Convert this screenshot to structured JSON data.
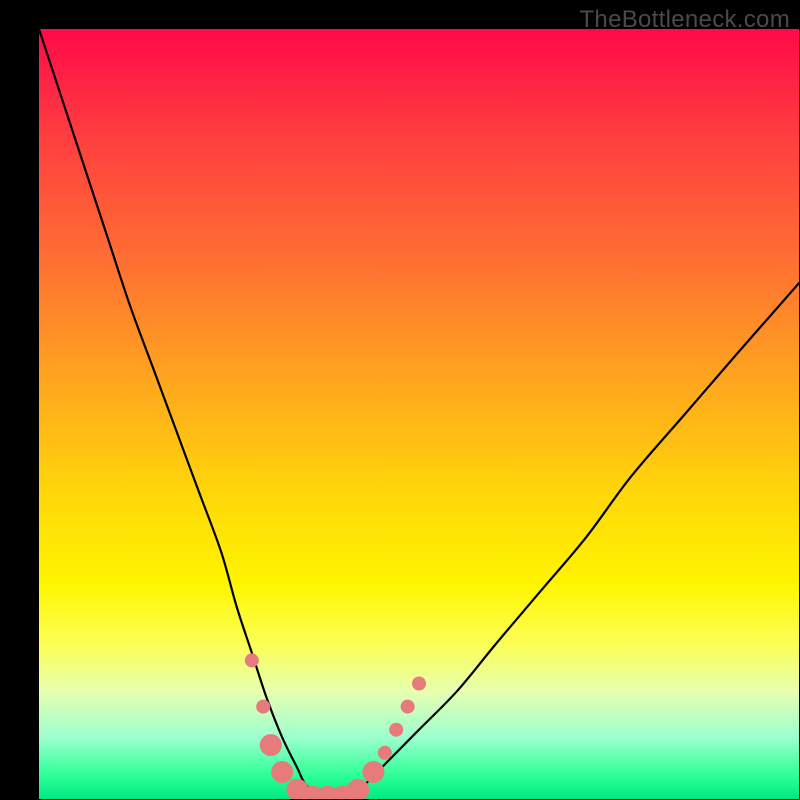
{
  "watermark": "TheBottleneck.com",
  "chart_data": {
    "type": "line",
    "title": "",
    "xlabel": "",
    "ylabel": "",
    "xlim": [
      0,
      100
    ],
    "ylim": [
      0,
      100
    ],
    "series": [
      {
        "name": "bottleneck-curve",
        "x": [
          0,
          3,
          6,
          9,
          12,
          15,
          18,
          21,
          24,
          26,
          28,
          30,
          32,
          34,
          35,
          37,
          39,
          41,
          43,
          46,
          50,
          55,
          60,
          66,
          72,
          78,
          85,
          92,
          100
        ],
        "values": [
          100,
          91,
          82,
          73,
          64,
          56,
          48,
          40,
          32,
          25,
          19,
          13,
          8,
          4,
          2,
          0,
          0,
          0,
          2,
          5,
          9,
          14,
          20,
          27,
          34,
          42,
          50,
          58,
          67
        ]
      }
    ],
    "markers": {
      "name": "highlight-points",
      "color": "#e77a7a",
      "radius_small": 7,
      "radius_large": 11,
      "points": [
        {
          "x": 28.0,
          "y": 18.0,
          "r": "small"
        },
        {
          "x": 29.5,
          "y": 12.0,
          "r": "small"
        },
        {
          "x": 30.5,
          "y": 7.0,
          "r": "large"
        },
        {
          "x": 32.0,
          "y": 3.5,
          "r": "large"
        },
        {
          "x": 34.0,
          "y": 1.2,
          "r": "large"
        },
        {
          "x": 36.0,
          "y": 0.3,
          "r": "large"
        },
        {
          "x": 38.0,
          "y": 0.3,
          "r": "large"
        },
        {
          "x": 40.0,
          "y": 0.3,
          "r": "large"
        },
        {
          "x": 42.0,
          "y": 1.2,
          "r": "large"
        },
        {
          "x": 44.0,
          "y": 3.5,
          "r": "large"
        },
        {
          "x": 45.5,
          "y": 6.0,
          "r": "small"
        },
        {
          "x": 47.0,
          "y": 9.0,
          "r": "small"
        },
        {
          "x": 48.5,
          "y": 12.0,
          "r": "small"
        },
        {
          "x": 50.0,
          "y": 15.0,
          "r": "small"
        }
      ]
    }
  }
}
